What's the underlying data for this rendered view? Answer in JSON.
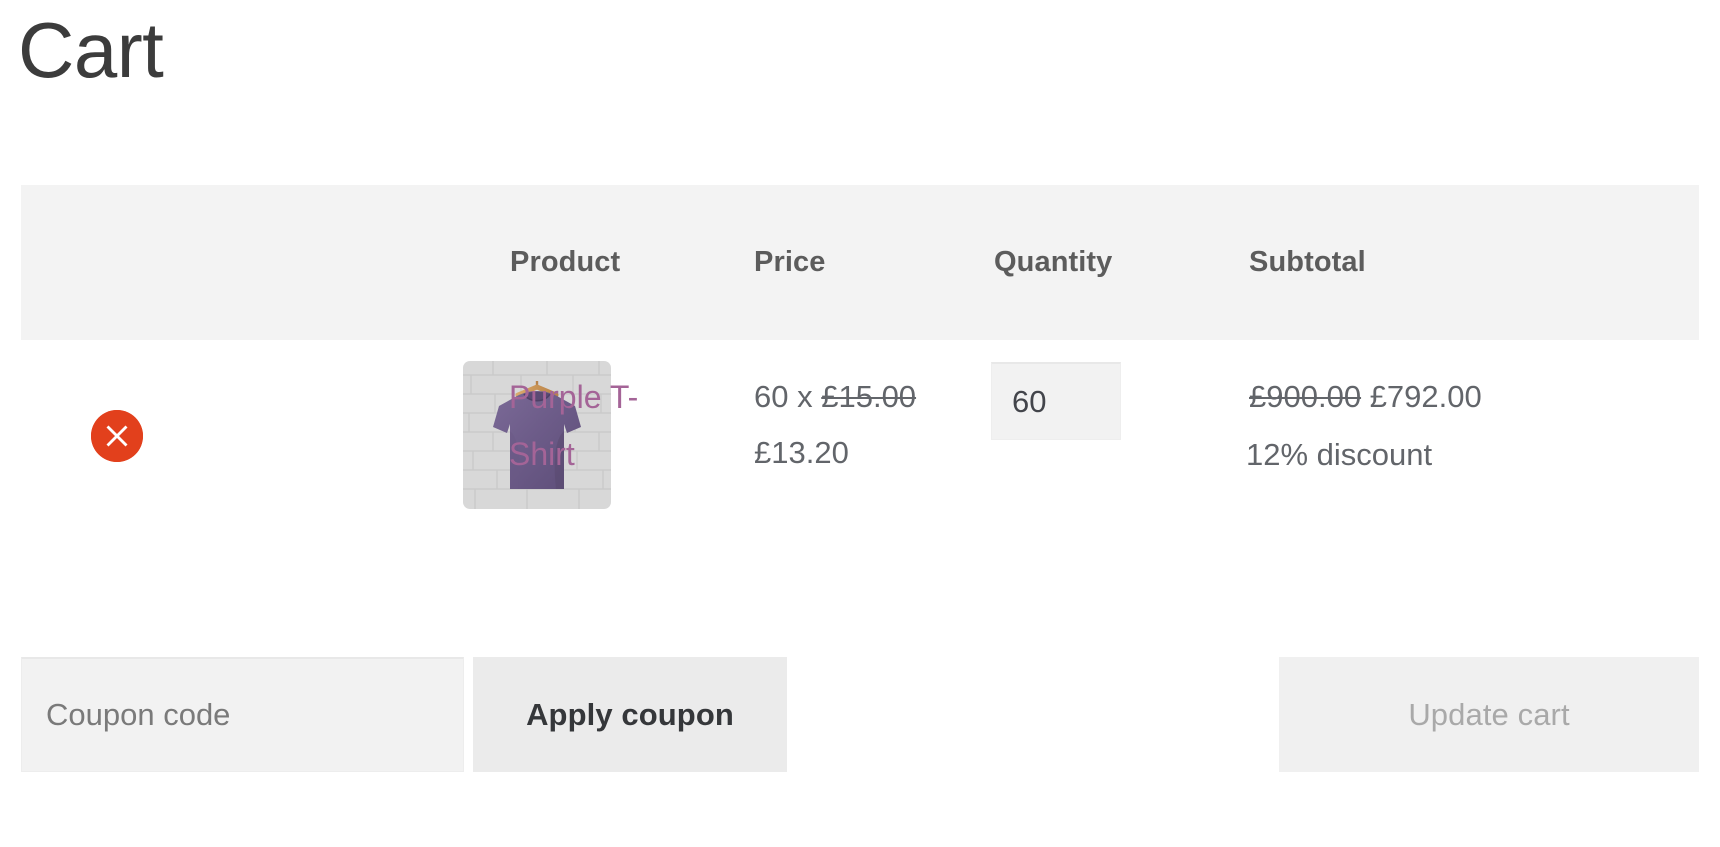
{
  "page": {
    "title": "Cart"
  },
  "table": {
    "headers": {
      "remove": "",
      "thumbnail": "",
      "product": "Product",
      "price": "Price",
      "quantity": "Quantity",
      "subtotal": "Subtotal"
    },
    "rows": [
      {
        "remove_label": "×",
        "remove_title": "Remove this item",
        "thumbnail_alt": "Purple T-Shirt",
        "product_name": "Purple T-Shirt",
        "price_quantity_prefix": "60 x",
        "price_regular": "£15.00",
        "price_sale": "£13.20",
        "quantity_value": "60",
        "subtotal_regular": "£900.00",
        "subtotal_sale": "£792.00",
        "discount_note": "12% discount"
      }
    ]
  },
  "actions": {
    "coupon_placeholder": "Coupon code",
    "coupon_value": "",
    "apply_coupon_label": "Apply coupon",
    "update_cart_label": "Update cart"
  },
  "colors": {
    "accent_link": "#a46497",
    "remove_button": "#e2401c",
    "header_bg": "#f3f3f3",
    "text_primary": "#43454b",
    "text_muted": "#62656a",
    "disabled_text": "#a9a9a9"
  }
}
